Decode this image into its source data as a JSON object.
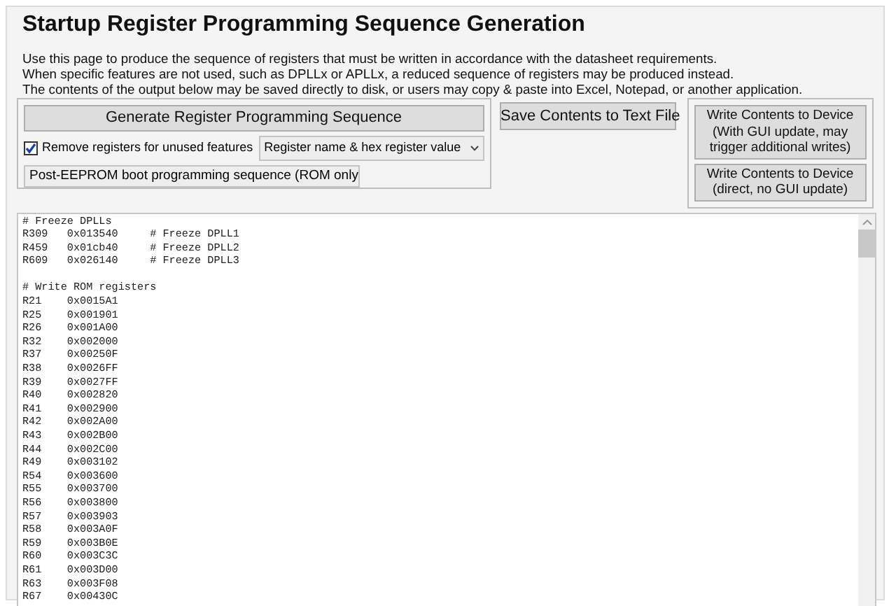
{
  "title": "Startup Register Programming Sequence Generation",
  "description": [
    "Use this page to produce the sequence of registers that must be written in accordance with the datasheet requirements.",
    "When specific features are not used, such as DPLLx or APLLx, a reduced sequence of registers may be produced instead.",
    "The contents of the output below may be saved directly to disk, or users may copy & paste into Excel, Notepad, or another application."
  ],
  "generate_button": "Generate Register Programming Sequence",
  "remove_unused": {
    "label": "Remove registers for unused features",
    "checked": true
  },
  "format_select": "Register name & hex register value",
  "sequence_select": "Post-EEPROM boot programming sequence (ROM only",
  "save_button": "Save Contents to Text File",
  "write_buttons": [
    {
      "lines": [
        "Write Contents to Device",
        "(With GUI update, may",
        "trigger additional writes)"
      ]
    },
    {
      "lines": [
        "Write Contents to Device",
        "(direct, no GUI update)"
      ]
    }
  ],
  "output_groups": [
    [
      "# Freeze DPLLs",
      "R309   0x013540     # Freeze DPLL1",
      "R459   0x01cb40     # Freeze DPLL2",
      "R609   0x026140     # Freeze DPLL3"
    ],
    [
      "# Write ROM registers",
      "R21    0x0015A1",
      "R25    0x001901",
      "R26    0x001A00",
      "R32    0x002000",
      "R37    0x00250F",
      "R38    0x0026FF",
      "R39    0x0027FF",
      "R40    0x002820",
      "R41    0x002900",
      "R42    0x002A00",
      "R43    0x002B00",
      "R44    0x002C00",
      "R49    0x003102",
      "R54    0x003600",
      "R55    0x003700",
      "R56    0x003800",
      "R57    0x003903",
      "R58    0x003A0F",
      "R59    0x003B0E",
      "R60    0x003C3C",
      "R61    0x003D00",
      "R63    0x003F08",
      "R67    0x00430C"
    ]
  ]
}
